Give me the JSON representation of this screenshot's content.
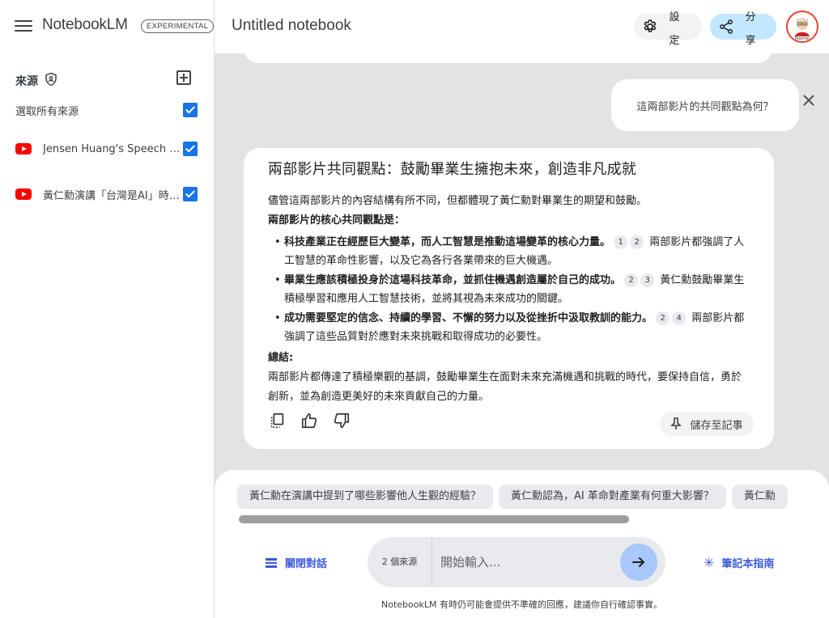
{
  "app": {
    "logo": "NotebookLM",
    "badge": "EXPERIMENTAL"
  },
  "sidebar": {
    "sources_label": "來源",
    "select_all_label": "選取所有來源",
    "sources": [
      {
        "label": "Jensen Huang's Speech at NTU Graduation Ceremony",
        "icon": "youtube-icon",
        "checked": true
      },
      {
        "label": "黃仁勳演講「台灣是AI」時代的核心",
        "icon": "youtube-icon",
        "checked": true
      }
    ]
  },
  "header": {
    "title": "Untitled notebook",
    "settings_label": "設定",
    "share_label": "分享",
    "avatar_text": "Teacher"
  },
  "chat": {
    "user_message": "這兩部影片的共同觀點為何？",
    "answer": {
      "title": "兩部影片共同觀點：鼓勵畢業生擁抱未來，創造非凡成就",
      "intro": "儘管這兩部影片的內容結構有所不同，但都體現了黃仁勳對畢業生的期望和鼓勵。",
      "core_label": "兩部影片的核心共同觀點是：",
      "points": [
        {
          "bold": "科技產業正在經歷巨大變革，而人工智慧是推動這場變革的核心力量。",
          "cites": [
            "1",
            "2"
          ],
          "text": "兩部影片都強調了人工智慧的革命性影響，以及它為各行各業帶來的巨大機遇。"
        },
        {
          "bold": "畢業生應該積極投身於這場科技革命，並抓住機遇創造屬於自己的成功。",
          "cites": [
            "2",
            "3"
          ],
          "text": "黃仁勳鼓勵畢業生積極學習和應用人工智慧技術，並將其視為未來成功的關鍵。"
        },
        {
          "bold": "成功需要堅定的信念、持續的學習、不懈的努力以及從挫折中汲取教訓的能力。",
          "cites": [
            "2",
            "4"
          ],
          "text": "兩部影片都強調了這些品質對於應對未來挑戰和取得成功的必要性。"
        }
      ],
      "summary_label": "總結:",
      "summary": "兩部影片都傳達了積極樂觀的基調，鼓勵畢業生在面對未來充滿機遇和挑戰的時代，要保持自信，勇於創新，並為創造更美好的未來貢獻自己的力量。",
      "save_label": "儲存至記事"
    }
  },
  "bottom": {
    "suggestions": [
      "黃仁勳在演講中提到了哪些影響他人生觀的經驗？",
      "黃仁勳認為，AI 革命對產業有何重大影響？",
      "黃仁勳"
    ],
    "close_chat_label": "關閉對話",
    "source_count": "2 個來源",
    "input_placeholder": "開始輸入...",
    "guide_label": "筆記本指南",
    "disclaimer": "NotebookLM 有時仍可能會提供不準確的回應，建議你自行確認事實。"
  },
  "colors": {
    "accent_blue": "#1a73e8",
    "share_bg": "#c2e7ff",
    "send_bg": "#a8c7fa",
    "youtube_red": "#ff0000",
    "link_blue": "#3b5bdb"
  }
}
